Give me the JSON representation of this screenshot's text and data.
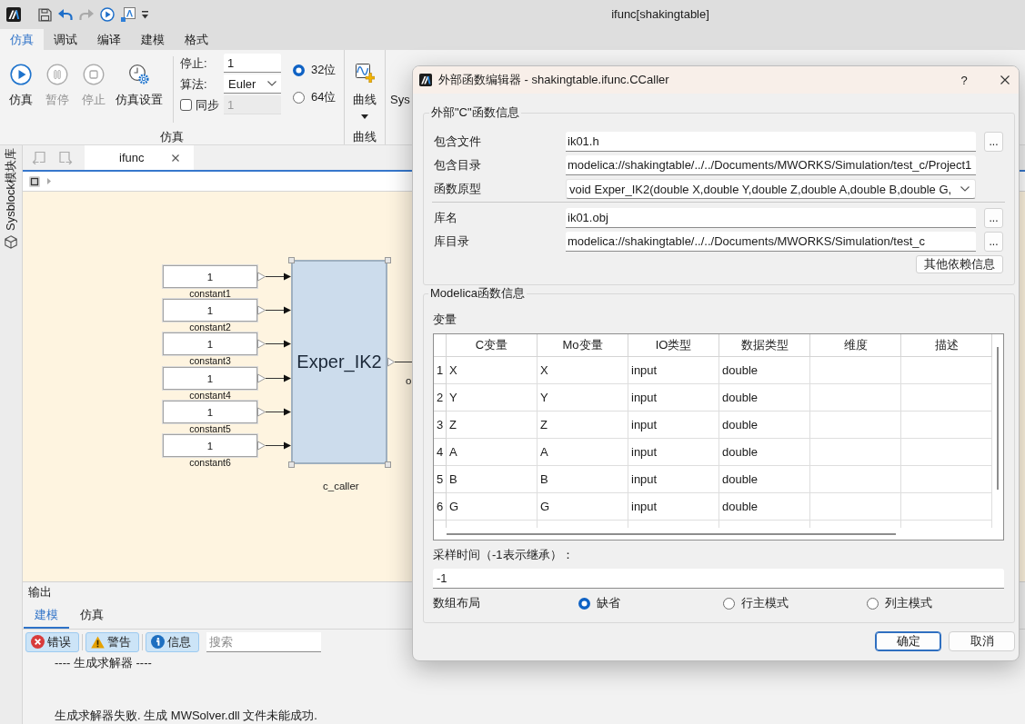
{
  "window": {
    "title": "ifunc[shakingtable]"
  },
  "quick_access": [
    {
      "kind": "save",
      "disabled": false
    },
    {
      "kind": "undo",
      "disabled": false
    },
    {
      "kind": "redo",
      "disabled": true
    },
    {
      "kind": "run",
      "disabled": false
    },
    {
      "kind": "model",
      "disabled": false
    },
    {
      "kind": "customize",
      "disabled": false
    }
  ],
  "ribbon": {
    "tabs": [
      {
        "label": "仿真",
        "selected": true
      },
      {
        "label": "调试",
        "selected": false
      },
      {
        "label": "编译",
        "selected": false
      },
      {
        "label": "建模",
        "selected": false
      },
      {
        "label": "格式",
        "selected": false
      }
    ],
    "simulation_group": {
      "label": "仿真",
      "buttons": [
        {
          "kind": "run",
          "label": "仿真",
          "disabled": false
        },
        {
          "kind": "pause",
          "label": "暂停",
          "disabled": true
        },
        {
          "kind": "stop",
          "label": "停止",
          "disabled": true
        },
        {
          "kind": "settings",
          "label": "仿真设置",
          "disabled": false
        }
      ],
      "stop_time": {
        "label": "停止:",
        "value": "1"
      },
      "algorithm": {
        "label": "算法:",
        "value": "Euler"
      },
      "sync": {
        "label": "同步",
        "checked": false,
        "value": "1",
        "disabled": true
      },
      "bitness": [
        {
          "label": "32位",
          "selected": true
        },
        {
          "label": "64位",
          "selected": false
        }
      ]
    },
    "curve_group": {
      "label": "曲线",
      "button_label": "曲线"
    },
    "next_group": {
      "button_label": "Sys"
    }
  },
  "sidebar": {
    "label": "Sysblock模块库"
  },
  "editor": {
    "nav_buttons": [
      {
        "kind": "back",
        "disabled": true
      },
      {
        "kind": "forward",
        "disabled": true
      }
    ],
    "tabs": [
      {
        "label": "ifunc",
        "selected": true
      }
    ],
    "canvas": {
      "constants": [
        {
          "value": "1",
          "label": "constant1"
        },
        {
          "value": "1",
          "label": "constant2"
        },
        {
          "value": "1",
          "label": "constant3"
        },
        {
          "value": "1",
          "label": "constant4"
        },
        {
          "value": "1",
          "label": "constant5"
        },
        {
          "value": "1",
          "label": "constant6"
        }
      ],
      "caller": {
        "text": "Exper_IK2",
        "label": "c_caller",
        "selected": true
      },
      "output_label": "o"
    }
  },
  "output": {
    "title": "输出",
    "tabs": [
      {
        "label": "建模",
        "selected": true
      },
      {
        "label": "仿真",
        "selected": false
      }
    ],
    "filters": [
      {
        "kind": "error",
        "label": "错误",
        "on": true
      },
      {
        "kind": "warning",
        "label": "警告",
        "on": true
      },
      {
        "kind": "info",
        "label": "信息",
        "on": true
      }
    ],
    "search": {
      "placeholder": "搜索"
    },
    "lines": [
      "---- 生成求解器 ----",
      "生成求解器失败. 生成 MWSolver.dll 文件未能成功."
    ]
  },
  "dialog": {
    "title": "外部函数编辑器 - shakingtable.ifunc.CCaller",
    "help": "?",
    "c_function": {
      "title": "外部\"C\"函数信息",
      "function_rows": [
        {
          "kind": "field",
          "label": "包含文件",
          "value": "ik01.h",
          "browse": "..."
        },
        {
          "kind": "field",
          "label": "包含目录",
          "value": "modelica://shakingtable/../../Documents/MWORKS/Simulation/test_c/Project1"
        },
        {
          "kind": "combo",
          "label": "函数原型",
          "value": "void Exper_IK2(double X,double Y,double Z,double A,double B,double G,"
        }
      ],
      "library_rows": [
        {
          "kind": "field",
          "label": "库名",
          "value": "ik01.obj",
          "browse": "..."
        },
        {
          "kind": "field",
          "label": "库目录",
          "value": "modelica://shakingtable/../../Documents/MWORKS/Simulation/test_c",
          "browse": "..."
        }
      ],
      "more_button": "其他依赖信息"
    },
    "modelica": {
      "title": "Modelica函数信息",
      "table_label": "变量",
      "columns": [
        "C变量",
        "Mo变量",
        "IO类型",
        "数据类型",
        "维度",
        "描述"
      ],
      "rows": [
        {
          "number": "1",
          "cells": [
            "X",
            "X",
            "input",
            "double"
          ]
        },
        {
          "number": "2",
          "cells": [
            "Y",
            "Y",
            "input",
            "double"
          ]
        },
        {
          "number": "3",
          "cells": [
            "Z",
            "Z",
            "input",
            "double"
          ]
        },
        {
          "number": "4",
          "cells": [
            "A",
            "A",
            "input",
            "double"
          ]
        },
        {
          "number": "5",
          "cells": [
            "B",
            "B",
            "input",
            "double"
          ]
        },
        {
          "number": "6",
          "cells": [
            "G",
            "G",
            "input",
            "double"
          ]
        }
      ],
      "sample_time": {
        "label": "采样时间（-1表示继承）：",
        "value": "-1"
      },
      "array_layout": {
        "label": "数组布局",
        "options": [
          {
            "label": "缺省",
            "selected": true
          },
          {
            "label": "行主模式",
            "selected": false
          },
          {
            "label": "列主模式",
            "selected": false
          }
        ]
      }
    },
    "buttons": [
      {
        "label": "确定",
        "default": true
      },
      {
        "label": "取消",
        "default": false
      }
    ]
  }
}
